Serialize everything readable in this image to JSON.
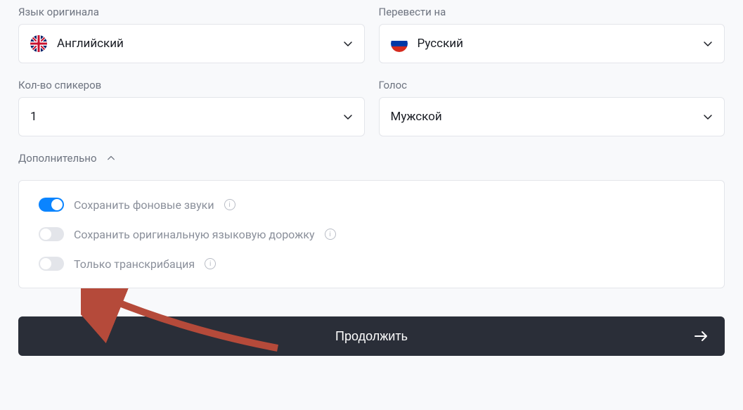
{
  "source_language": {
    "label": "Язык оригинала",
    "value": "Английский"
  },
  "target_language": {
    "label": "Перевести на",
    "value": "Русский"
  },
  "speakers": {
    "label": "Кол-во спикеров",
    "value": "1"
  },
  "voice": {
    "label": "Голос",
    "value": "Мужской"
  },
  "additional": {
    "label": "Дополнительно",
    "options": [
      {
        "label": "Сохранить фоновые звуки",
        "enabled": true
      },
      {
        "label": "Сохранить оригинальную языковую дорожку",
        "enabled": false
      },
      {
        "label": "Только транскрибация",
        "enabled": false
      }
    ]
  },
  "continue_button": "Продолжить"
}
